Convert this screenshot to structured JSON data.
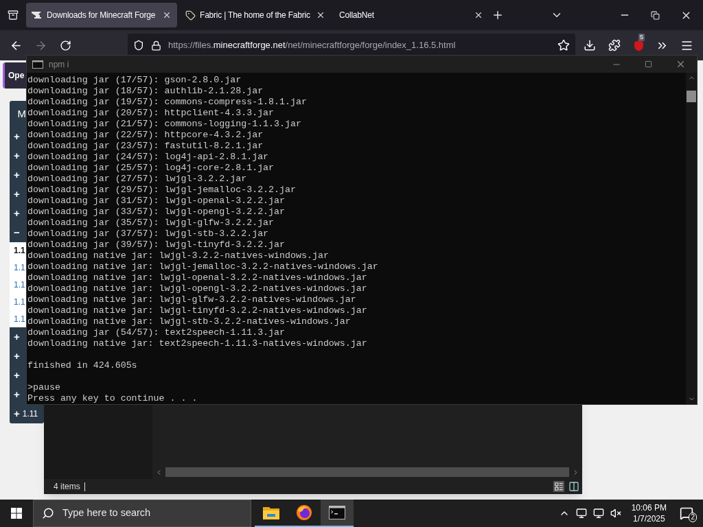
{
  "browser": {
    "tabs": [
      {
        "title": "Downloads for Minecraft Forge",
        "selected": true,
        "kind": "forge"
      },
      {
        "title": "Fabric | The home of the Fabric",
        "selected": false,
        "kind": "fabric"
      },
      {
        "title": "CollabNet",
        "selected": false,
        "kind": "blank"
      }
    ],
    "url": {
      "prefix": "https://files.",
      "domain": "minecraftforge.net",
      "path": "/net/minecraftforge/forge/index_1.16.5.html"
    },
    "extension_badge": "5"
  },
  "page": {
    "banner": "Ope",
    "sidebar": {
      "header": "M",
      "items": [
        {
          "kind": "toggle",
          "symbol": "+"
        },
        {
          "kind": "toggle",
          "symbol": "+"
        },
        {
          "kind": "toggle",
          "symbol": "+"
        },
        {
          "kind": "toggle",
          "symbol": "+"
        },
        {
          "kind": "toggle",
          "symbol": "+"
        },
        {
          "kind": "toggle",
          "symbol": "−"
        },
        {
          "kind": "version",
          "label": "1.1",
          "selected": true
        },
        {
          "kind": "version",
          "label": "1.1",
          "selected": false
        },
        {
          "kind": "version",
          "label": "1.1",
          "selected": false
        },
        {
          "kind": "version",
          "label": "1.1",
          "selected": false
        },
        {
          "kind": "version",
          "label": "1.1",
          "selected": false
        },
        {
          "kind": "toggle",
          "symbol": "+"
        },
        {
          "kind": "toggle",
          "symbol": "+"
        },
        {
          "kind": "toggle",
          "symbol": "+"
        },
        {
          "kind": "toggle",
          "symbol": "+"
        },
        {
          "kind": "toggle",
          "symbol": "+",
          "label": "1.11"
        }
      ]
    }
  },
  "explorer": {
    "status": "4 items"
  },
  "terminal": {
    "title": "npm i",
    "blocks": [
      [
        "downloading jar (17/57): gson-2.8.0.jar",
        "downloading jar (18/57): authlib-2.1.28.jar",
        "downloading jar (19/57): commons-compress-1.8.1.jar",
        "downloading jar (20/57): httpclient-4.3.3.jar",
        "downloading jar (21/57): commons-logging-1.1.3.jar",
        "downloading jar (22/57): httpcore-4.3.2.jar",
        "downloading jar (23/57): fastutil-8.2.1.jar",
        "downloading jar (24/57): log4j-api-2.8.1.jar",
        "downloading jar (25/57): log4j-core-2.8.1.jar",
        "downloading jar (27/57): lwjgl-3.2.2.jar",
        "downloading jar (29/57): lwjgl-jemalloc-3.2.2.jar",
        "downloading jar (31/57): lwjgl-openal-3.2.2.jar",
        "downloading jar (33/57): lwjgl-opengl-3.2.2.jar",
        "downloading jar (35/57): lwjgl-glfw-3.2.2.jar",
        "downloading jar (37/57): lwjgl-stb-3.2.2.jar",
        "downloading jar (39/57): lwjgl-tinyfd-3.2.2.jar",
        "downloading native jar: lwjgl-3.2.2-natives-windows.jar",
        "downloading native jar: lwjgl-jemalloc-3.2.2-natives-windows.jar",
        "downloading native jar: lwjgl-openal-3.2.2-natives-windows.jar",
        "downloading native jar: lwjgl-opengl-3.2.2-natives-windows.jar",
        "downloading native jar: lwjgl-glfw-3.2.2-natives-windows.jar",
        "downloading native jar: lwjgl-tinyfd-3.2.2-natives-windows.jar",
        "downloading native jar: lwjgl-stb-3.2.2-natives-windows.jar",
        "downloading jar (54/57): text2speech-1.11.3.jar",
        "downloading native jar: text2speech-1.11.3-natives-windows.jar"
      ],
      [
        "finished in 424.605s"
      ],
      [
        ">pause",
        "Press any key to continue . . ."
      ]
    ]
  },
  "taskbar": {
    "search_placeholder": "Type here to search",
    "apps": [
      {
        "kind": "explorer",
        "active": false
      },
      {
        "kind": "firefox",
        "active": false
      },
      {
        "kind": "terminal",
        "active": true
      }
    ],
    "time": "10:06 PM",
    "date": "1/7/2025",
    "notifications": "2"
  }
}
